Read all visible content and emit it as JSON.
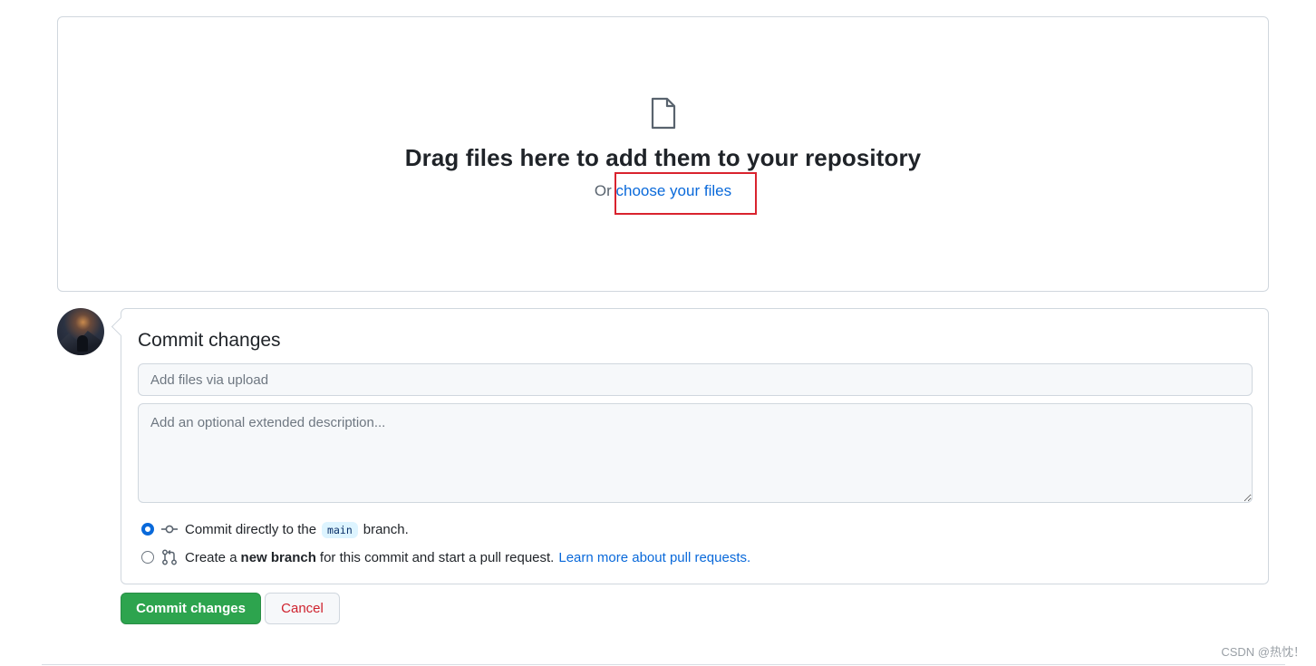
{
  "dropzone": {
    "icon": "file-icon",
    "title": "Drag files here to add them to your repository",
    "or_text": "Or ",
    "choose_link": "choose your files"
  },
  "commit": {
    "title": "Commit changes",
    "summary_placeholder": "Add files via upload",
    "description_placeholder": "Add an optional extended description...",
    "option_direct": {
      "checked": true,
      "icon": "git-commit-icon",
      "prefix": "Commit directly to the",
      "branch": "main",
      "suffix": "branch."
    },
    "option_new_branch": {
      "checked": false,
      "icon": "git-pull-request-icon",
      "prefix": "Create a",
      "bold": "new branch",
      "suffix": "for this commit and start a pull request.",
      "learn_more": "Learn more about pull requests."
    }
  },
  "buttons": {
    "commit": "Commit changes",
    "cancel": "Cancel"
  },
  "watermark": "CSDN @热忱！",
  "colors": {
    "primary_button": "#2da44e",
    "link": "#0969da",
    "cancel_text": "#cf222e",
    "highlight_box": "#d9232e"
  }
}
